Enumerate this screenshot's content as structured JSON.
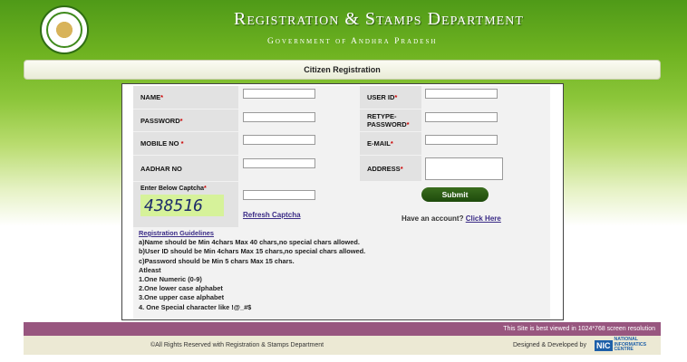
{
  "header": {
    "title": "Registration & Stamps Department",
    "subtitle": "Government of Andhra Pradesh"
  },
  "page_title": "Citizen Registration",
  "form": {
    "name_label": "NAME",
    "userid_label": "USER ID",
    "password_label": "PASSWORD",
    "retype_label_1": "RETYPE-",
    "retype_label_2": "PASSWORD",
    "mobile_label": "MOBILE NO",
    "email_label": "E-MAIL",
    "aadhar_label": "AADHAR NO",
    "address_label": "ADDRESS",
    "captcha_label": "Enter Below Captcha",
    "captcha_value": "438516",
    "refresh_label": "Refresh Captcha",
    "submit_label": "Submit",
    "have_account": "Have an account?",
    "click_here": "Click Here",
    "required_mark": "*"
  },
  "guidelines": {
    "title": "Registration Guidelines",
    "lines": [
      "a)Name should be Min 4chars Max 40 chars,no special chars allowed.",
      "b)User ID should be Min 4chars Max 15 chars,no special chars allowed.",
      "c)Password should be Min 5 chars Max 15 chars.",
      "Atleast",
      "1.One Numeric (0-9)",
      "2.One lower case alphabet",
      "3.One upper case alphabet",
      "4. One Special character like !@_#$"
    ]
  },
  "footer": {
    "best_viewed": "This Site is best viewed in 1024*768 screen resolution",
    "copyright": "©All Rights Reserved with Registration & Stamps Department",
    "designed_by": "Designed & Developed by",
    "nic_logo": "NIC",
    "nic_text_1": "NATIONAL",
    "nic_text_2": "INFORMATICS",
    "nic_text_3": "CENTRE"
  },
  "colors": {
    "header_green": "#5aa31d",
    "footer_band": "#98567f",
    "submit_green": "#2c5a14",
    "link": "#3a2b86",
    "required": "#cc0000"
  },
  "icons": {
    "emblem": "ap-state-emblem-icon",
    "nic": "nic-logo-icon"
  }
}
